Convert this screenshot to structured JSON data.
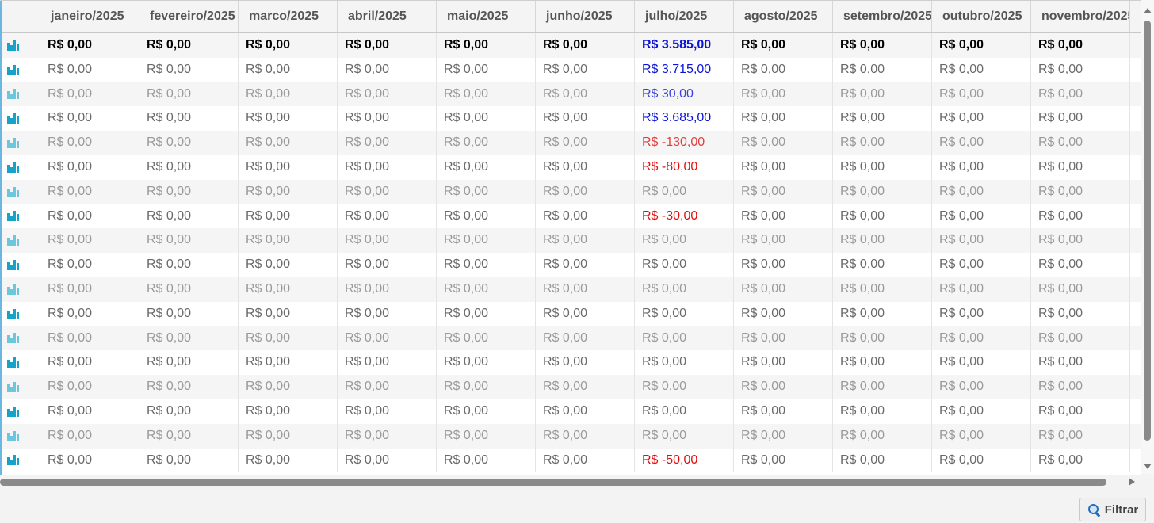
{
  "columns": [
    "janeiro/2025",
    "fevereiro/2025",
    "marco/2025",
    "abril/2025",
    "maio/2025",
    "junho/2025",
    "julho/2025",
    "agosto/2025",
    "setembro/2025",
    "outubro/2025",
    "novembro/2025"
  ],
  "icon": "bar-chart-icon",
  "colors": {
    "positive": "#0b13d8",
    "negative": "#e01010",
    "icon": "#17a3c7"
  },
  "rows": [
    {
      "values": [
        "R$ 0,00",
        "R$ 0,00",
        "R$ 0,00",
        "R$ 0,00",
        "R$ 0,00",
        "R$ 0,00",
        "R$ 3.585,00",
        "R$ 0,00",
        "R$ 0,00",
        "R$ 0,00",
        "R$ 0,00"
      ],
      "style": "bold",
      "julho_color": "positive"
    },
    {
      "values": [
        "R$ 0,00",
        "R$ 0,00",
        "R$ 0,00",
        "R$ 0,00",
        "R$ 0,00",
        "R$ 0,00",
        "R$ 3.715,00",
        "R$ 0,00",
        "R$ 0,00",
        "R$ 0,00",
        "R$ 0,00"
      ],
      "style": "norm",
      "julho_color": "positive"
    },
    {
      "values": [
        "R$ 0,00",
        "R$ 0,00",
        "R$ 0,00",
        "R$ 0,00",
        "R$ 0,00",
        "R$ 0,00",
        "R$ 30,00",
        "R$ 0,00",
        "R$ 0,00",
        "R$ 0,00",
        "R$ 0,00"
      ],
      "style": "dim",
      "julho_color": "positive"
    },
    {
      "values": [
        "R$ 0,00",
        "R$ 0,00",
        "R$ 0,00",
        "R$ 0,00",
        "R$ 0,00",
        "R$ 0,00",
        "R$ 3.685,00",
        "R$ 0,00",
        "R$ 0,00",
        "R$ 0,00",
        "R$ 0,00"
      ],
      "style": "norm",
      "julho_color": "positive"
    },
    {
      "values": [
        "R$ 0,00",
        "R$ 0,00",
        "R$ 0,00",
        "R$ 0,00",
        "R$ 0,00",
        "R$ 0,00",
        "R$ -130,00",
        "R$ 0,00",
        "R$ 0,00",
        "R$ 0,00",
        "R$ 0,00"
      ],
      "style": "dim",
      "julho_color": "negative"
    },
    {
      "values": [
        "R$ 0,00",
        "R$ 0,00",
        "R$ 0,00",
        "R$ 0,00",
        "R$ 0,00",
        "R$ 0,00",
        "R$ -80,00",
        "R$ 0,00",
        "R$ 0,00",
        "R$ 0,00",
        "R$ 0,00"
      ],
      "style": "norm",
      "julho_color": "negative"
    },
    {
      "values": [
        "R$ 0,00",
        "R$ 0,00",
        "R$ 0,00",
        "R$ 0,00",
        "R$ 0,00",
        "R$ 0,00",
        "R$ 0,00",
        "R$ 0,00",
        "R$ 0,00",
        "R$ 0,00",
        "R$ 0,00"
      ],
      "style": "dim",
      "julho_color": ""
    },
    {
      "values": [
        "R$ 0,00",
        "R$ 0,00",
        "R$ 0,00",
        "R$ 0,00",
        "R$ 0,00",
        "R$ 0,00",
        "R$ -30,00",
        "R$ 0,00",
        "R$ 0,00",
        "R$ 0,00",
        "R$ 0,00"
      ],
      "style": "norm",
      "julho_color": "negative"
    },
    {
      "values": [
        "R$ 0,00",
        "R$ 0,00",
        "R$ 0,00",
        "R$ 0,00",
        "R$ 0,00",
        "R$ 0,00",
        "R$ 0,00",
        "R$ 0,00",
        "R$ 0,00",
        "R$ 0,00",
        "R$ 0,00"
      ],
      "style": "dim",
      "julho_color": ""
    },
    {
      "values": [
        "R$ 0,00",
        "R$ 0,00",
        "R$ 0,00",
        "R$ 0,00",
        "R$ 0,00",
        "R$ 0,00",
        "R$ 0,00",
        "R$ 0,00",
        "R$ 0,00",
        "R$ 0,00",
        "R$ 0,00"
      ],
      "style": "norm",
      "julho_color": ""
    },
    {
      "values": [
        "R$ 0,00",
        "R$ 0,00",
        "R$ 0,00",
        "R$ 0,00",
        "R$ 0,00",
        "R$ 0,00",
        "R$ 0,00",
        "R$ 0,00",
        "R$ 0,00",
        "R$ 0,00",
        "R$ 0,00"
      ],
      "style": "dim",
      "julho_color": ""
    },
    {
      "values": [
        "R$ 0,00",
        "R$ 0,00",
        "R$ 0,00",
        "R$ 0,00",
        "R$ 0,00",
        "R$ 0,00",
        "R$ 0,00",
        "R$ 0,00",
        "R$ 0,00",
        "R$ 0,00",
        "R$ 0,00"
      ],
      "style": "norm",
      "julho_color": ""
    },
    {
      "values": [
        "R$ 0,00",
        "R$ 0,00",
        "R$ 0,00",
        "R$ 0,00",
        "R$ 0,00",
        "R$ 0,00",
        "R$ 0,00",
        "R$ 0,00",
        "R$ 0,00",
        "R$ 0,00",
        "R$ 0,00"
      ],
      "style": "dim",
      "julho_color": ""
    },
    {
      "values": [
        "R$ 0,00",
        "R$ 0,00",
        "R$ 0,00",
        "R$ 0,00",
        "R$ 0,00",
        "R$ 0,00",
        "R$ 0,00",
        "R$ 0,00",
        "R$ 0,00",
        "R$ 0,00",
        "R$ 0,00"
      ],
      "style": "norm",
      "julho_color": ""
    },
    {
      "values": [
        "R$ 0,00",
        "R$ 0,00",
        "R$ 0,00",
        "R$ 0,00",
        "R$ 0,00",
        "R$ 0,00",
        "R$ 0,00",
        "R$ 0,00",
        "R$ 0,00",
        "R$ 0,00",
        "R$ 0,00"
      ],
      "style": "dim",
      "julho_color": ""
    },
    {
      "values": [
        "R$ 0,00",
        "R$ 0,00",
        "R$ 0,00",
        "R$ 0,00",
        "R$ 0,00",
        "R$ 0,00",
        "R$ 0,00",
        "R$ 0,00",
        "R$ 0,00",
        "R$ 0,00",
        "R$ 0,00"
      ],
      "style": "norm",
      "julho_color": ""
    },
    {
      "values": [
        "R$ 0,00",
        "R$ 0,00",
        "R$ 0,00",
        "R$ 0,00",
        "R$ 0,00",
        "R$ 0,00",
        "R$ 0,00",
        "R$ 0,00",
        "R$ 0,00",
        "R$ 0,00",
        "R$ 0,00"
      ],
      "style": "dim",
      "julho_color": ""
    },
    {
      "values": [
        "R$ 0,00",
        "R$ 0,00",
        "R$ 0,00",
        "R$ 0,00",
        "R$ 0,00",
        "R$ 0,00",
        "R$ -50,00",
        "R$ 0,00",
        "R$ 0,00",
        "R$ 0,00",
        "R$ 0,00"
      ],
      "style": "norm",
      "julho_color": "negative"
    }
  ],
  "footer": {
    "filter_label": "Filtrar",
    "filter_icon": "search-icon"
  }
}
